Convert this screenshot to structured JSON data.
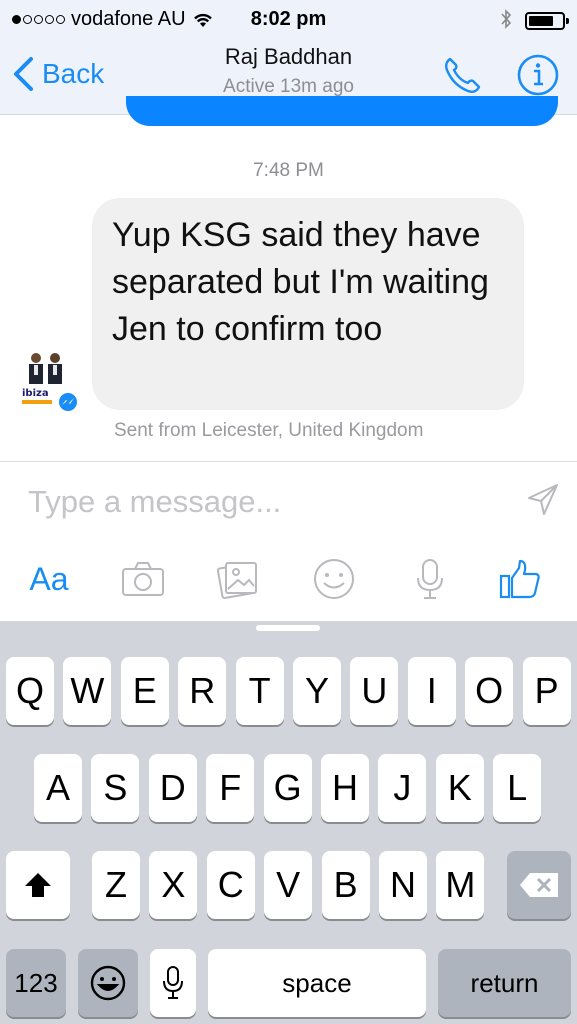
{
  "status_bar": {
    "carrier": "vodafone AU",
    "time": "8:02 pm",
    "battery_level": 0.75,
    "signal_filled": 1,
    "signal_total": 5
  },
  "nav": {
    "back_label": "Back",
    "contact_name": "Raj Baddhan",
    "contact_status": "Active 13m ago"
  },
  "conversation": {
    "timestamp": "7:48 PM",
    "messages": [
      {
        "text": "Yup KSG said they have separated but I'm waiting Jen to confirm too",
        "location": "Sent from Leicester, United Kingdom"
      }
    ]
  },
  "avatar": {
    "logo_text": "ibiza"
  },
  "composer": {
    "placeholder": "Type a message...",
    "tools": [
      "Aa",
      "camera-icon",
      "gallery-icon",
      "emoji-icon",
      "microphone-icon",
      "thumbs-up-icon"
    ],
    "text_tool_label": "Aa"
  },
  "keyboard": {
    "row1": [
      "Q",
      "W",
      "E",
      "R",
      "T",
      "Y",
      "U",
      "I",
      "O",
      "P"
    ],
    "row2": [
      "A",
      "S",
      "D",
      "F",
      "G",
      "H",
      "J",
      "K",
      "L"
    ],
    "row3": [
      "Z",
      "X",
      "C",
      "V",
      "B",
      "N",
      "M"
    ],
    "num_label": "123",
    "space_label": "space",
    "return_label": "return"
  },
  "colors": {
    "accent": "#1a8cf5",
    "bubble_in": "#f1f0f0",
    "bubble_out": "#0a84ff",
    "keyboard_bg": "#d1d5db"
  }
}
